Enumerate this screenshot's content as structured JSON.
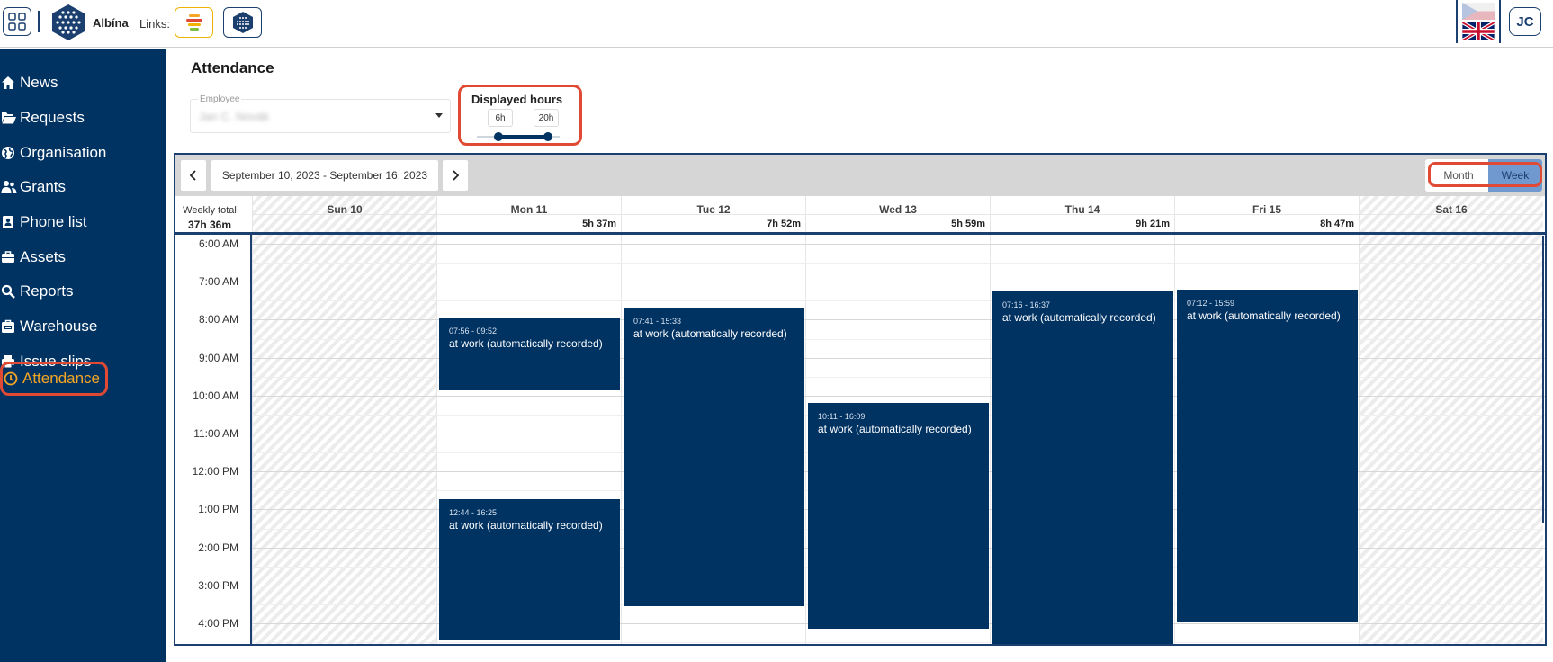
{
  "header": {
    "brand": "Albína",
    "links_label": "Links:",
    "user_initials": "JC"
  },
  "sidebar": {
    "items": [
      {
        "label": "News",
        "icon": "home-icon"
      },
      {
        "label": "Requests",
        "icon": "folder-open-icon"
      },
      {
        "label": "Organisation",
        "icon": "globe-icon"
      },
      {
        "label": "Grants",
        "icon": "users-icon"
      },
      {
        "label": "Phone list",
        "icon": "address-book-icon"
      },
      {
        "label": "Assets",
        "icon": "briefcase-icon"
      },
      {
        "label": "Reports",
        "icon": "search-icon"
      },
      {
        "label": "Warehouse",
        "icon": "warehouse-icon"
      },
      {
        "label": "Issue slips",
        "icon": "printer-icon"
      },
      {
        "label": "Attendance",
        "icon": "clock-icon",
        "active": true
      }
    ]
  },
  "main": {
    "title": "Attendance",
    "employee": {
      "label": "Employee",
      "value": "Jan C. Novák"
    },
    "displayed_hours": {
      "title": "Displayed hours",
      "from": "6h",
      "to": "20h"
    }
  },
  "calendar": {
    "date_range": "September 10, 2023 - September 16, 2023",
    "view_month": "Month",
    "view_week": "Week",
    "weekly_total_label": "Weekly total",
    "weekly_total": "37h 36m",
    "days": [
      {
        "name": "Sun 10",
        "total": "",
        "weekend": true
      },
      {
        "name": "Mon 11",
        "total": "5h 37m",
        "weekend": false
      },
      {
        "name": "Tue 12",
        "total": "7h 52m",
        "weekend": false
      },
      {
        "name": "Wed 13",
        "total": "5h 59m",
        "weekend": false
      },
      {
        "name": "Thu 14",
        "total": "9h 21m",
        "weekend": false
      },
      {
        "name": "Fri 15",
        "total": "8h 47m",
        "weekend": false
      },
      {
        "name": "Sat 16",
        "total": "",
        "weekend": true
      }
    ],
    "times": [
      "6:00 AM",
      "7:00 AM",
      "8:00 AM",
      "9:00 AM",
      "10:00 AM",
      "11:00 AM",
      "12:00 PM",
      "1:00 PM",
      "2:00 PM",
      "3:00 PM",
      "4:00 PM"
    ],
    "events": [
      {
        "day": 1,
        "start": "07:56",
        "end": "09:52",
        "time": "07:56 - 09:52",
        "desc": "at work (automatically recorded)"
      },
      {
        "day": 1,
        "start": "12:44",
        "end": "16:25",
        "time": "12:44 - 16:25",
        "desc": "at work (automatically recorded)"
      },
      {
        "day": 2,
        "start": "07:41",
        "end": "15:33",
        "time": "07:41 - 15:33",
        "desc": "at work (automatically recorded)"
      },
      {
        "day": 3,
        "start": "10:11",
        "end": "16:09",
        "time": "10:11 - 16:09",
        "desc": "at work (automatically recorded)"
      },
      {
        "day": 4,
        "start": "07:16",
        "end": "16:37",
        "time": "07:16 - 16:37",
        "desc": "at work (automatically recorded)"
      },
      {
        "day": 5,
        "start": "07:12",
        "end": "15:59",
        "time": "07:12 - 15:59",
        "desc": "at work (automatically recorded)"
      }
    ],
    "accent_color": "#003262",
    "highlight_color": "#e04a35"
  }
}
